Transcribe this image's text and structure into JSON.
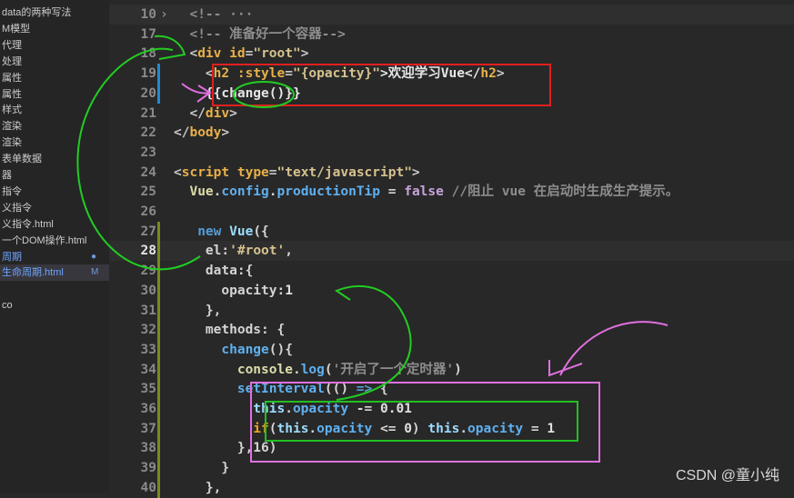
{
  "sidebar": {
    "items": [
      {
        "label": "data的两种写法"
      },
      {
        "label": "M模型"
      },
      {
        "label": "代理"
      },
      {
        "label": "处理"
      },
      {
        "label": "属性"
      },
      {
        "label": "属性"
      },
      {
        "label": "样式"
      },
      {
        "label": "渲染"
      },
      {
        "label": "渲染"
      },
      {
        "label": "表单数据"
      },
      {
        "label": "器"
      },
      {
        "label": "指令"
      },
      {
        "label": "义指令"
      },
      {
        "label": "义指令.html"
      },
      {
        "label": "一个DOM操作.html"
      },
      {
        "label": "周期",
        "status": "●",
        "blue": true
      },
      {
        "label": "生命周期.html",
        "status": "M",
        "blue": true,
        "selected": true
      },
      {
        "label": ""
      },
      {
        "label": "co"
      }
    ]
  },
  "colors": {
    "tag": "#e8b04a",
    "punct": "#c8c8c8",
    "str": "#d6c28f",
    "comment": "#8d8d8d",
    "kw": "#569cd6",
    "prop": "#5fb0f0",
    "plain": "#d4d4d4",
    "bool": "#c7a3dc",
    "ctrl": "#f0a020",
    "num": "#e0e0e0",
    "obj": "#9cdcfe",
    "text": "#e6e6e6",
    "fn": "#dcdcaa"
  },
  "editor": {
    "lines": [
      {
        "num": "10",
        "fold": true,
        "tokens": [
          [
            "  <!-- ",
            "comment"
          ],
          [
            "···",
            "comment"
          ]
        ]
      },
      {
        "num": "17",
        "tokens": [
          [
            "  <!-- 准备好一个容器-->",
            "comment"
          ]
        ]
      },
      {
        "num": "18",
        "tokens": [
          [
            "  <",
            "punct"
          ],
          [
            "div",
            "tag"
          ],
          [
            " id",
            "tag"
          ],
          [
            "=",
            "punct"
          ],
          [
            "\"root\"",
            "str"
          ],
          [
            ">",
            "punct"
          ]
        ]
      },
      {
        "num": "19",
        "bar": "#1f8ad2",
        "tokens": [
          [
            "    <",
            "punct"
          ],
          [
            "h2",
            "tag"
          ],
          [
            " :style",
            "tag"
          ],
          [
            "=",
            "punct"
          ],
          [
            "\"{opacity}\"",
            "str"
          ],
          [
            ">欢迎学习Vue</",
            "text"
          ],
          [
            "h2",
            "tag"
          ],
          [
            ">",
            "punct"
          ]
        ]
      },
      {
        "num": "20",
        "bar": "#1f8ad2",
        "tokens": [
          [
            "    {{change()}}",
            "text"
          ]
        ]
      },
      {
        "num": "21",
        "tokens": [
          [
            "  </",
            "punct"
          ],
          [
            "div",
            "tag"
          ],
          [
            ">",
            "punct"
          ]
        ]
      },
      {
        "num": "22",
        "tokens": [
          [
            "</",
            "punct"
          ],
          [
            "body",
            "tag"
          ],
          [
            ">",
            "punct"
          ]
        ]
      },
      {
        "num": "23",
        "tokens": []
      },
      {
        "num": "24",
        "tokens": [
          [
            "<",
            "punct"
          ],
          [
            "script",
            "tag"
          ],
          [
            " type",
            "tag"
          ],
          [
            "=",
            "punct"
          ],
          [
            "\"text/javascript\"",
            "str"
          ],
          [
            ">",
            "punct"
          ]
        ]
      },
      {
        "num": "25",
        "tokens": [
          [
            "  Vue",
            "fn"
          ],
          [
            ".",
            "plain"
          ],
          [
            "config",
            "prop"
          ],
          [
            ".",
            "plain"
          ],
          [
            "productionTip",
            "prop"
          ],
          [
            " = ",
            "plain"
          ],
          [
            "false",
            "bool"
          ],
          [
            " //阻止 vue 在启动时生成生产提示。",
            "comment"
          ]
        ]
      },
      {
        "num": "26",
        "tokens": []
      },
      {
        "num": "27",
        "bar": "#7a8a1a",
        "tokens": [
          [
            "   new ",
            "kw"
          ],
          [
            "Vue",
            "obj"
          ],
          [
            "({",
            "plain"
          ]
        ]
      },
      {
        "num": "28",
        "bar": "#7a8a1a",
        "current": true,
        "tokens": [
          [
            "    el",
            "plain"
          ],
          [
            ":",
            "plain"
          ],
          [
            "'#root'",
            "str"
          ],
          [
            ",",
            "plain"
          ]
        ]
      },
      {
        "num": "29",
        "bar": "#7a8a1a",
        "tokens": [
          [
            "    data",
            "plain"
          ],
          [
            ":{",
            "plain"
          ]
        ]
      },
      {
        "num": "30",
        "bar": "#7a8a1a",
        "tokens": [
          [
            "      opacity",
            "plain"
          ],
          [
            ":",
            "plain"
          ],
          [
            "1",
            "num"
          ]
        ]
      },
      {
        "num": "31",
        "bar": "#7a8a1a",
        "tokens": [
          [
            "    },",
            "plain"
          ]
        ]
      },
      {
        "num": "32",
        "bar": "#7a8a1a",
        "tokens": [
          [
            "    methods",
            "plain"
          ],
          [
            ": {",
            "plain"
          ]
        ]
      },
      {
        "num": "33",
        "bar": "#7a8a1a",
        "tokens": [
          [
            "      change",
            "prop"
          ],
          [
            "(){",
            "plain"
          ]
        ]
      },
      {
        "num": "34",
        "bar": "#7a8a1a",
        "tokens": [
          [
            "        console",
            "fn"
          ],
          [
            ".",
            "plain"
          ],
          [
            "log",
            "prop"
          ],
          [
            "(",
            "plain"
          ],
          [
            "'开启了一个定时器'",
            "comment"
          ],
          [
            ")",
            "plain"
          ]
        ]
      },
      {
        "num": "35",
        "bar": "#7a8a1a",
        "tokens": [
          [
            "        setInterval",
            "prop"
          ],
          [
            "(() ",
            "plain"
          ],
          [
            "=>",
            "kw"
          ],
          [
            " {",
            "plain"
          ]
        ]
      },
      {
        "num": "36",
        "bar": "#7a8a1a",
        "tokens": [
          [
            "          this",
            "obj"
          ],
          [
            ".",
            "plain"
          ],
          [
            "opacity",
            "prop"
          ],
          [
            " -= ",
            "plain"
          ],
          [
            "0.01",
            "num"
          ]
        ]
      },
      {
        "num": "37",
        "bar": "#7a8a1a",
        "tokens": [
          [
            "          if",
            "ctrl"
          ],
          [
            "(",
            "plain"
          ],
          [
            "this",
            "obj"
          ],
          [
            ".",
            "plain"
          ],
          [
            "opacity",
            "prop"
          ],
          [
            " <= ",
            "plain"
          ],
          [
            "0",
            "num"
          ],
          [
            ") ",
            "plain"
          ],
          [
            "this",
            "obj"
          ],
          [
            ".",
            "plain"
          ],
          [
            "opacity",
            "prop"
          ],
          [
            " = ",
            "plain"
          ],
          [
            "1",
            "num"
          ]
        ]
      },
      {
        "num": "38",
        "bar": "#7a8a1a",
        "tokens": [
          [
            "        },16)",
            "plain"
          ]
        ]
      },
      {
        "num": "39",
        "bar": "#7a8a1a",
        "tokens": [
          [
            "      }",
            "plain"
          ]
        ]
      },
      {
        "num": "40",
        "bar": "#7a8a1a",
        "tokens": [
          [
            "    },",
            "plain"
          ]
        ]
      }
    ]
  },
  "watermark": "CSDN @童小纯"
}
